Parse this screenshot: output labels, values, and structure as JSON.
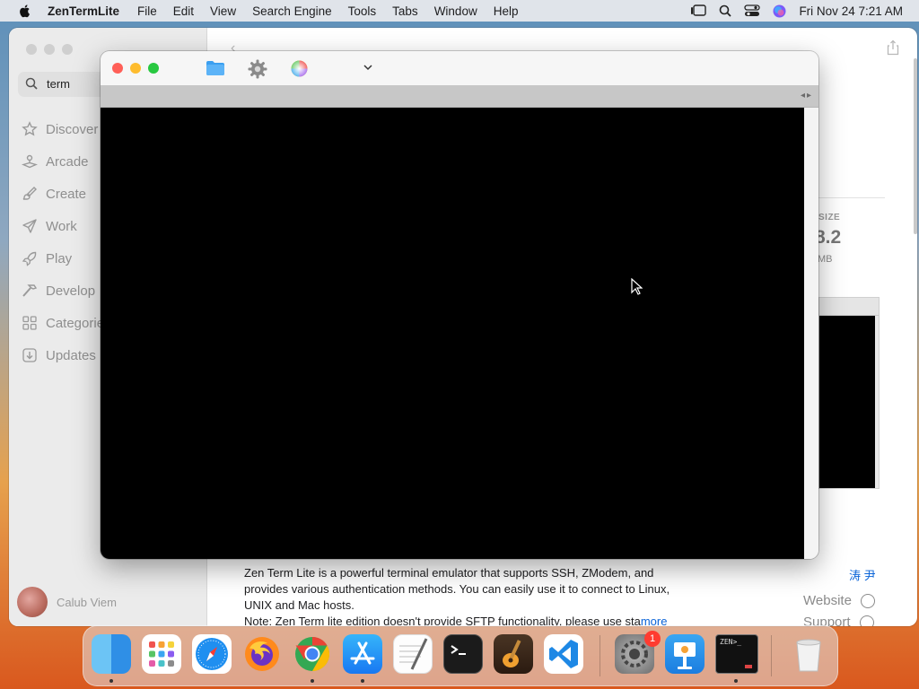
{
  "menubar": {
    "app_name": "ZenTermLite",
    "items": [
      "File",
      "Edit",
      "View",
      "Search Engine",
      "Tools",
      "Tabs",
      "Window",
      "Help"
    ],
    "clock": "Fri Nov 24  7:21 AM"
  },
  "appstore": {
    "search_value": "term",
    "sidebar": [
      "Discover",
      "Arcade",
      "Create",
      "Work",
      "Play",
      "Develop",
      "Categories",
      "Updates"
    ],
    "user_name": "Calub Viem",
    "size_label": "SIZE",
    "size_value": "8.2",
    "size_unit": "MB",
    "description_lines": [
      "Zen Term Lite is a powerful terminal emulator that supports SSH, ZModem, and",
      "provides various authentication methods. You can easily use it to connect to Linux,",
      "UNIX and Mac hosts.",
      "Note: Zen Term lite edition doesn't provide SFTP functionality, please use sta"
    ],
    "more_link": "more",
    "developer": "涛 尹",
    "website_link": "Website",
    "support_link": "Support"
  },
  "zen_window": {
    "tab_arrows": "◂▸"
  },
  "dock": {
    "apps": [
      "finder-icon",
      "launchpad-icon",
      "safari-icon",
      "firefox-icon",
      "chrome-icon",
      "app-store-icon",
      "textedit-icon",
      "terminal-icon",
      "garageband-icon",
      "vscode-icon",
      "system-settings-icon",
      "keynote-icon",
      "zenterm-icon",
      "trash-icon"
    ],
    "settings_badge": "1",
    "zen_icon_text": "ZEN>_"
  },
  "colors": {
    "accent": "#0a64d8",
    "close": "#ff5f57",
    "minimize": "#febc2e",
    "zoom": "#28c840"
  }
}
